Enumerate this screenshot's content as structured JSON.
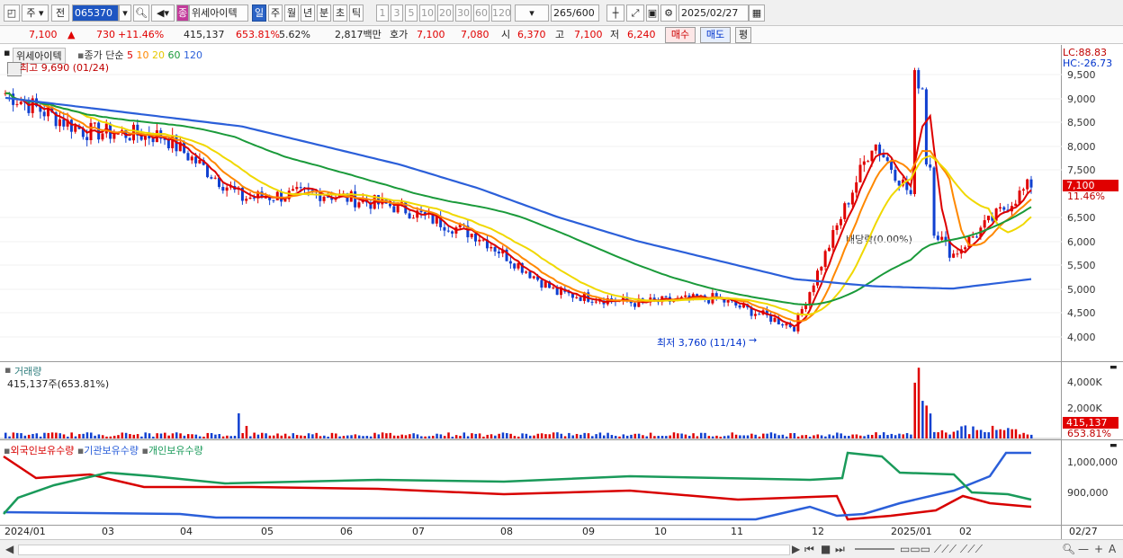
{
  "toolbar": {
    "market": "주",
    "prefix": "전",
    "stock_code": "065370",
    "stock_name": "위세아이텍",
    "stock_tag": "종",
    "periods": [
      "일",
      "주",
      "월",
      "년",
      "분",
      "초",
      "틱"
    ],
    "active_period": "일",
    "counts": [
      "1",
      "3",
      "5",
      "10",
      "20",
      "30",
      "60",
      "120"
    ],
    "count_value": "265",
    "count_total": "/600",
    "date": "2025/02/27"
  },
  "info": {
    "price": "7,100",
    "change": "730",
    "change_pct": "+11.46%",
    "volume": "415,137",
    "volume_ratio": "653.81%",
    "turnover": "5.62%",
    "amount": "2,817백만",
    "bid_label": "호가",
    "bid1": "7,100",
    "bid2": "7,080",
    "open_label": "시",
    "open": "6,370",
    "high_label": "고",
    "high": "7,100",
    "low_label": "저",
    "low": "6,240",
    "buy": "매수",
    "sell": "매도",
    "eval": "평"
  },
  "price_panel": {
    "stock_name": "위세아이텍",
    "ma_label": "종가 단순",
    "ma_periods": [
      "5",
      "10",
      "20",
      "60",
      "120"
    ],
    "ma_colors": [
      "#dd0000",
      "#ff8800",
      "#f0d800",
      "#1a9a3a",
      "#2b5fd9"
    ],
    "high_note": "최고 9,690 (01/24)",
    "low_note": "최저 3,760 (11/14)",
    "dividend_note": "배당락(0.00%)",
    "lc": "LC:88.83",
    "hc": "HC:-26.73",
    "last_price": "7,100",
    "last_pct": "11.46%",
    "ticks": [
      "9,500",
      "9,000",
      "8,500",
      "8,000",
      "7,500",
      "6,500",
      "6,000",
      "5,500",
      "5,000",
      "4,500",
      "4,000"
    ]
  },
  "volume_panel": {
    "title": "거래량",
    "value_label": "415,137주(653.81%)",
    "ticks": [
      "4,000K",
      "2,000K"
    ],
    "last": "415,137",
    "last_pct": "653.81%"
  },
  "holdings_panel": {
    "series": [
      "외국인보유수량",
      "기관보유수량",
      "개인보유수량"
    ],
    "series_colors": [
      "#d80000",
      "#2b5fd9",
      "#1a9a5a"
    ],
    "ticks": [
      "1,000,000",
      "900,000"
    ]
  },
  "x_axis": [
    "2024/01",
    "03",
    "04",
    "05",
    "06",
    "07",
    "08",
    "09",
    "10",
    "11",
    "12",
    "2025/01",
    "02",
    "02/27"
  ],
  "chart_data": {
    "type": "line",
    "price_close_monthly": {
      "x": [
        "2024-01",
        "2024-02",
        "2024-03",
        "2024-04",
        "2024-05",
        "2024-06",
        "2024-07",
        "2024-08",
        "2024-09",
        "2024-10",
        "2024-11",
        "2024-12",
        "2025-01",
        "2025-02"
      ],
      "y": [
        9000,
        8200,
        8100,
        6800,
        6900,
        6600,
        6000,
        4800,
        4600,
        4700,
        4100,
        8000,
        5600,
        7100
      ]
    },
    "ma120_monthly": [
      8900,
      8700,
      8500,
      8300,
      7900,
      7500,
      7000,
      6400,
      5900,
      5500,
      5100,
      4950,
      4900,
      5100
    ]
  }
}
